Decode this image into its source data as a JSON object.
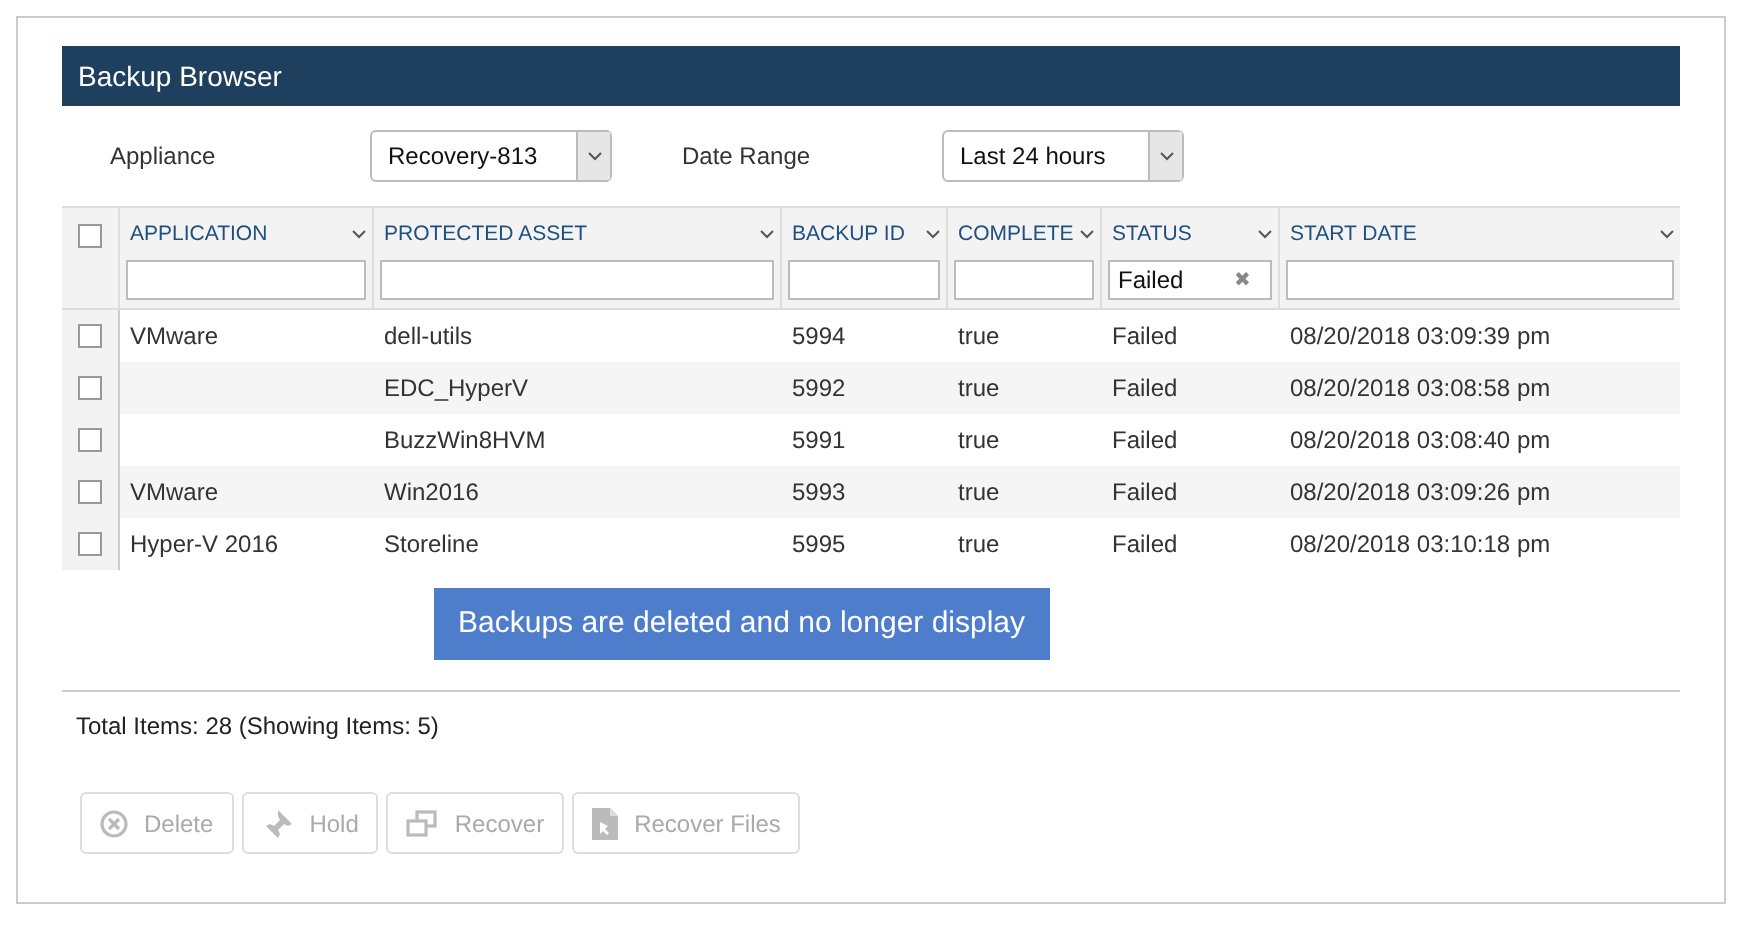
{
  "panel": {
    "title": "Backup Browser"
  },
  "filters": [
    {
      "label": "Appliance",
      "value": "Recovery-813"
    },
    {
      "label": "Date Range",
      "value": "Last 24 hours"
    }
  ],
  "table": {
    "select_all": {
      "checked": false
    },
    "columns": [
      {
        "label": "APPLICATION"
      },
      {
        "label": "PROTECTED ASSET"
      },
      {
        "label": "BACKUP ID"
      },
      {
        "label": "COMPLETE"
      },
      {
        "label": "STATUS",
        "filter": "Failed",
        "clear": "✖"
      },
      {
        "label": "START DATE"
      }
    ],
    "rows": [
      {
        "checked": false,
        "cells": [
          "VMware",
          "dell-utils",
          "5994",
          "true",
          "Failed",
          "08/20/2018 03:09:39 pm"
        ]
      },
      {
        "checked": false,
        "cells": [
          "",
          "EDC_HyperV",
          "5992",
          "true",
          "Failed",
          "08/20/2018 03:08:58 pm"
        ]
      },
      {
        "checked": false,
        "cells": [
          "",
          "BuzzWin8HVM",
          "5991",
          "true",
          "Failed",
          "08/20/2018 03:08:40 pm"
        ]
      },
      {
        "checked": false,
        "cells": [
          "VMware",
          "Win2016",
          "5993",
          "true",
          "Failed",
          "08/20/2018 03:09:26 pm"
        ]
      },
      {
        "checked": false,
        "cells": [
          "Hyper-V 2016",
          "Storeline",
          "5995",
          "true",
          "Failed",
          "08/20/2018 03:10:18 pm"
        ]
      }
    ]
  },
  "callout": "Backups are deleted and no longer display",
  "status": "Total Items: 28 (Showing Items: 5)",
  "buttons": [
    {
      "kind": "delete",
      "label": "Delete",
      "disabled": true
    },
    {
      "kind": "hold",
      "label": "Hold",
      "disabled": true
    },
    {
      "kind": "recover",
      "label": "Recover",
      "disabled": true
    },
    {
      "kind": "files",
      "label": "Recover Files",
      "disabled": true
    }
  ]
}
